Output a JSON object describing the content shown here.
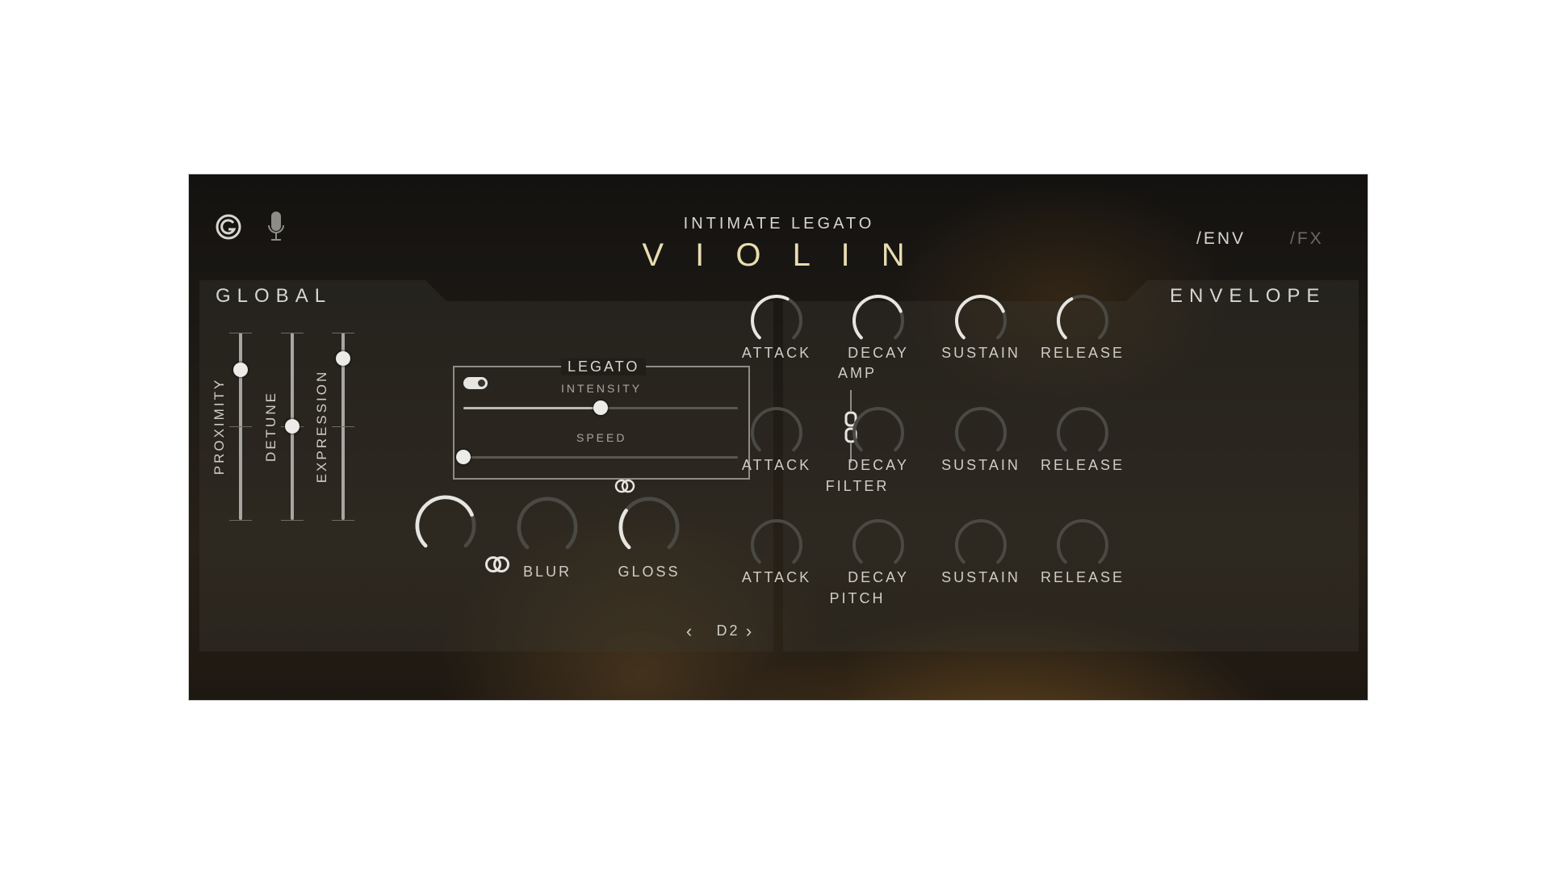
{
  "header": {
    "subtitle": "INTIMATE LEGATO",
    "title": "V I O L I N",
    "tab_env": "/ENV",
    "tab_fx": "/FX"
  },
  "icons": {
    "logo": "g-logo-icon",
    "mic": "microphone-icon",
    "link": "chain-link-icon",
    "stereo": "double-ring-icon"
  },
  "colors": {
    "title": "#e8dcb0",
    "text": "#d8d6d0",
    "inactive": "#6b6a65",
    "knob_active": "#e6e5e0",
    "knob_inactive": "#4a4944"
  },
  "global": {
    "title": "GLOBAL",
    "faders": [
      {
        "label": "PROXIMITY",
        "value": 0.8
      },
      {
        "label": "DETUNE",
        "value": 0.5
      },
      {
        "label": "EXPRESSION",
        "value": 0.86
      }
    ],
    "legato": {
      "title": "LEGATO",
      "toggle_on": true,
      "intensity": {
        "label": "INTENSITY",
        "value": 0.5
      },
      "speed": {
        "label": "SPEED",
        "value": 0.0
      }
    },
    "knobs": [
      {
        "label": "",
        "value": 0.75,
        "active": true
      },
      {
        "label": "BLUR",
        "value": 0.0,
        "active": false
      },
      {
        "label": "GLOSS",
        "value": 0.3,
        "active": true
      }
    ],
    "note": {
      "prev": "‹",
      "value": "D2",
      "next": "›"
    }
  },
  "envelope": {
    "title": "ENVELOPE",
    "rows": [
      {
        "label": "AMP",
        "knobs": [
          {
            "label": "ATTACK",
            "value": 0.6,
            "active": true
          },
          {
            "label": "DECAY",
            "value": 0.75,
            "active": true
          },
          {
            "label": "SUSTAIN",
            "value": 0.75,
            "active": true
          },
          {
            "label": "RELEASE",
            "value": 0.4,
            "active": true
          }
        ]
      },
      {
        "label": "FILTER",
        "knobs": [
          {
            "label": "ATTACK",
            "value": 0.0,
            "active": false
          },
          {
            "label": "DECAY",
            "value": 0.0,
            "active": false
          },
          {
            "label": "SUSTAIN",
            "value": 0.0,
            "active": false
          },
          {
            "label": "RELEASE",
            "value": 0.0,
            "active": false
          }
        ]
      },
      {
        "label": "PITCH",
        "knobs": [
          {
            "label": "ATTACK",
            "value": 0.0,
            "active": false
          },
          {
            "label": "DECAY",
            "value": 0.0,
            "active": false
          },
          {
            "label": "SUSTAIN",
            "value": 0.0,
            "active": false
          },
          {
            "label": "RELEASE",
            "value": 0.0,
            "active": false
          }
        ]
      }
    ]
  }
}
